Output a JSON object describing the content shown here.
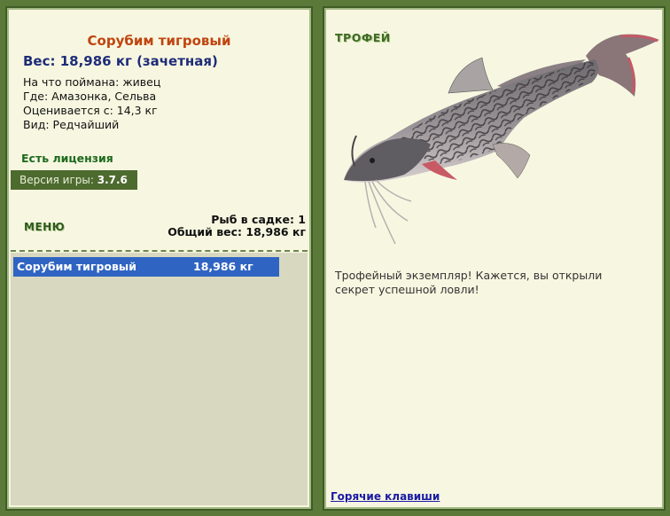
{
  "fish": {
    "name": "Сорубим тигровый",
    "weight_line": "Вес: 18,986 кг (зачетная)",
    "caught_on": "На что поймана: живец",
    "where": "Где: Амазонка, Сельва",
    "min_weight": "Оценивается с: 14,3 кг",
    "rarity": "Вид: Редчайший"
  },
  "license": "Есть лицензия",
  "version": {
    "label": "Версия игры:",
    "value": "3.7.6"
  },
  "menu_label": "МЕНЮ",
  "keep": {
    "count_line": "Рыб в садке: 1",
    "total_line": "Общий вес: 18,986 кг"
  },
  "keep_list": [
    {
      "name": "Сорубим тигровый",
      "weight": "18,986 кг"
    }
  ],
  "trophy": {
    "label": "ТРОФЕЙ",
    "message": "Трофейный экземпляр! Кажется, вы открыли секрет успешной ловли!"
  },
  "hotkeys_link": "Горячие клавиши",
  "colors": {
    "background": "#5b7a3a",
    "panel": "#f7f7e1",
    "fish_name": "#c0440e",
    "weight": "#1e2c78",
    "selection": "#2f64c2"
  }
}
